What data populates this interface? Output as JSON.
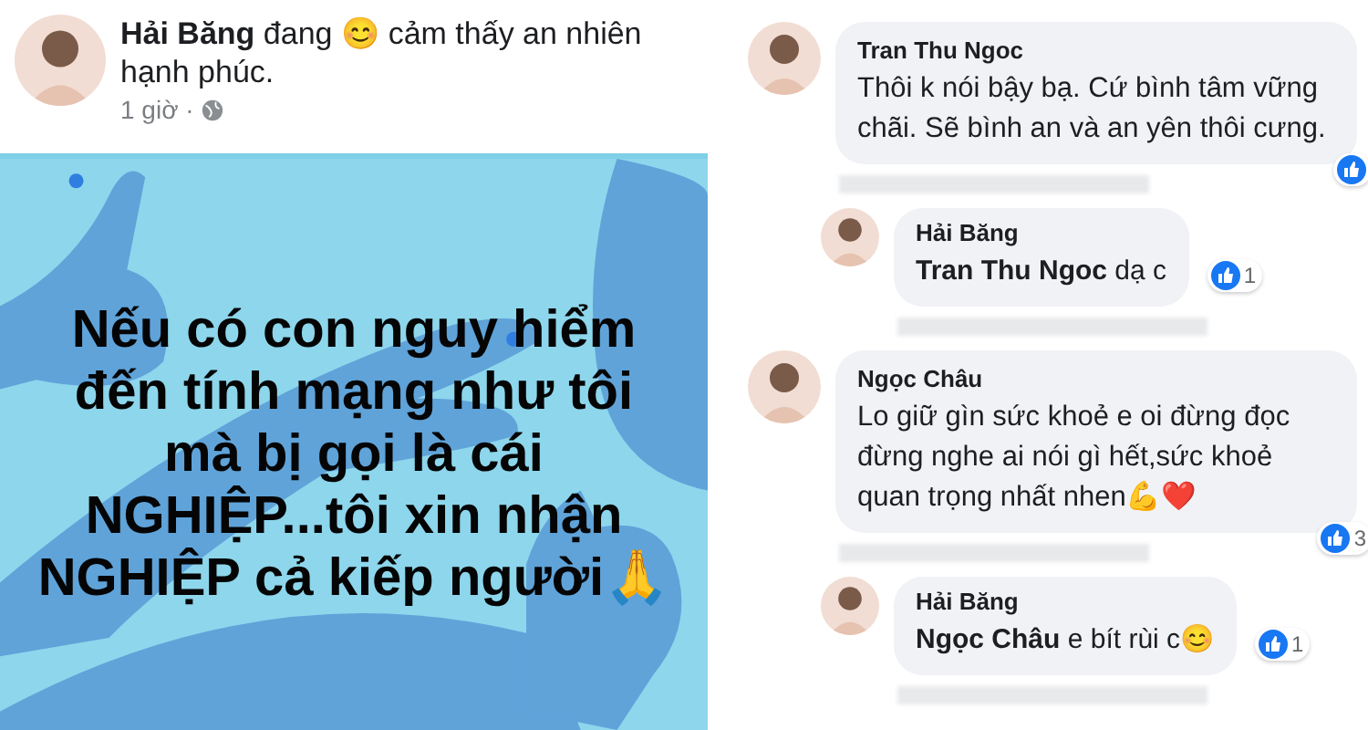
{
  "post": {
    "status": "**Hải Băng** đang 😊 cảm thấy an nhiên hạnh phúc.",
    "time": "1 giờ ·",
    "text_lines": [
      "Nếu có con nguy hiểm",
      "đến tính mạng như tôi",
      "mà bị gọi là cái",
      "NGHIỆP...tôi xin nhận",
      "NGHIỆP cả kiếp người🙏"
    ]
  },
  "comments": [
    {
      "author": "Tran Thu Ngoc",
      "text": "Thôi k nói bậy bạ. Cứ bình tâm vững chãi. Sẽ bình an và an yên thôi cưng.",
      "liked": true,
      "replies": [
        {
          "author": "Hải Băng",
          "text": "**Tran Thu Ngoc** dạ c",
          "liked": true,
          "likes": "1"
        }
      ]
    },
    {
      "author": "Ngọc Châu",
      "text": "Lo giữ gìn sức khoẻ e oi đừng đọc đừng nghe ai nói gì hết,sức khoẻ quan trọng nhất nhen💪❤️",
      "liked": true,
      "likes": "3",
      "replies": [
        {
          "author": "Hải Băng",
          "text": "**Ngọc Châu** e bít rùi c😊",
          "liked": true,
          "likes": "1"
        }
      ]
    }
  ]
}
